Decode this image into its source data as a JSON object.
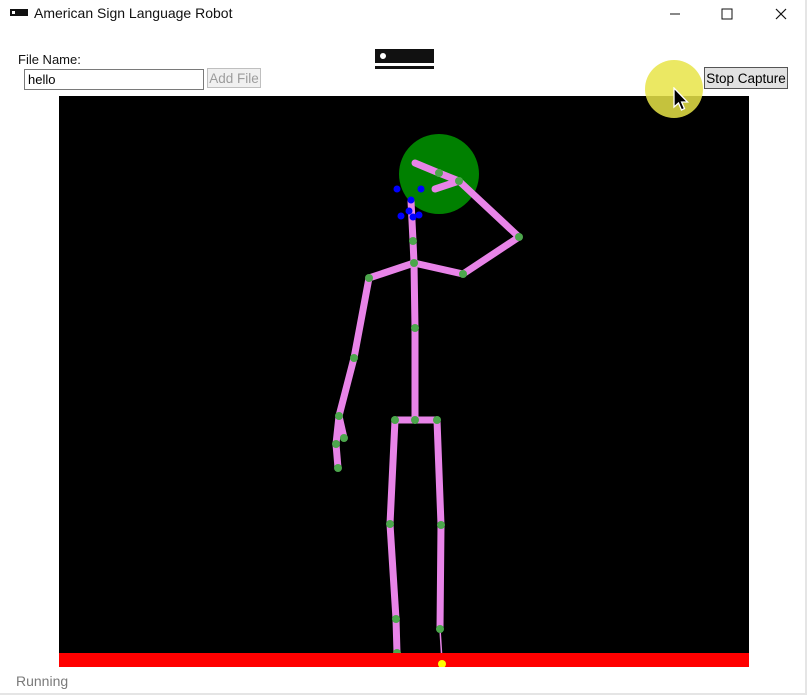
{
  "window": {
    "title": "American Sign Language Robot",
    "icon": "window-app-icon",
    "controls": [
      "minimize-icon",
      "maximize-icon",
      "close-icon"
    ]
  },
  "form": {
    "file_label": "File Name:",
    "file_value": "hello",
    "add_label": "Add File",
    "stop_label": "Stop Capture"
  },
  "status": {
    "text": "Running"
  },
  "colors": {
    "canvas_bg": "#000000",
    "skeleton_bone": "#e884e8",
    "joint": "#4ca64c",
    "head": "#008000",
    "hand_tip": "#0000ff",
    "floor": "#ff0000",
    "foot_marker": "#ffff00",
    "cursor_highlight": "#e8e448"
  }
}
